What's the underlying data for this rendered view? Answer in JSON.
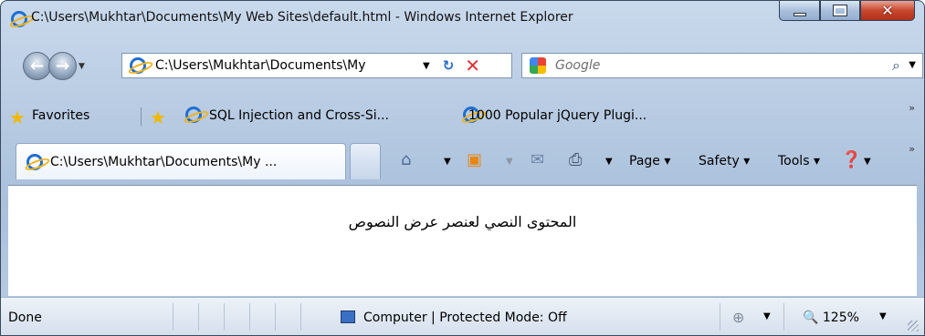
{
  "window": {
    "title": "C:\\Users\\Mukhtar\\Documents\\My Web Sites\\default.html - Windows Internet Explorer"
  },
  "address_bar": {
    "value": "C:\\Users\\Mukhtar\\Documents\\My",
    "search_placeholder": "Google"
  },
  "favorites_bar": {
    "label": "Favorites",
    "items": [
      "SQL Injection and Cross-Si...",
      "1000 Popular jQuery Plugi..."
    ]
  },
  "tab": {
    "label": "C:\\Users\\Mukhtar\\Documents\\My ..."
  },
  "command_bar": {
    "page": "Page",
    "safety": "Safety",
    "tools": "Tools"
  },
  "content": {
    "text": "المحتوى النصي لعنصر عرض النصوص"
  },
  "status_bar": {
    "status": "Done",
    "zone": "Computer | Protected Mode: Off",
    "zoom": "125%"
  },
  "colors": {
    "frame": "#b9cde4",
    "close_button": "#c9482f",
    "link_blue": "#1e6fd1"
  },
  "icons": [
    "ie-icon",
    "back-icon",
    "forward-icon",
    "refresh-icon",
    "stop-icon",
    "google-icon",
    "search-icon",
    "favorites-star-icon",
    "add-favorites-icon",
    "home-icon",
    "rss-icon",
    "mail-icon",
    "print-icon",
    "help-icon",
    "computer-icon",
    "globe-icon",
    "zoom-icon"
  ]
}
